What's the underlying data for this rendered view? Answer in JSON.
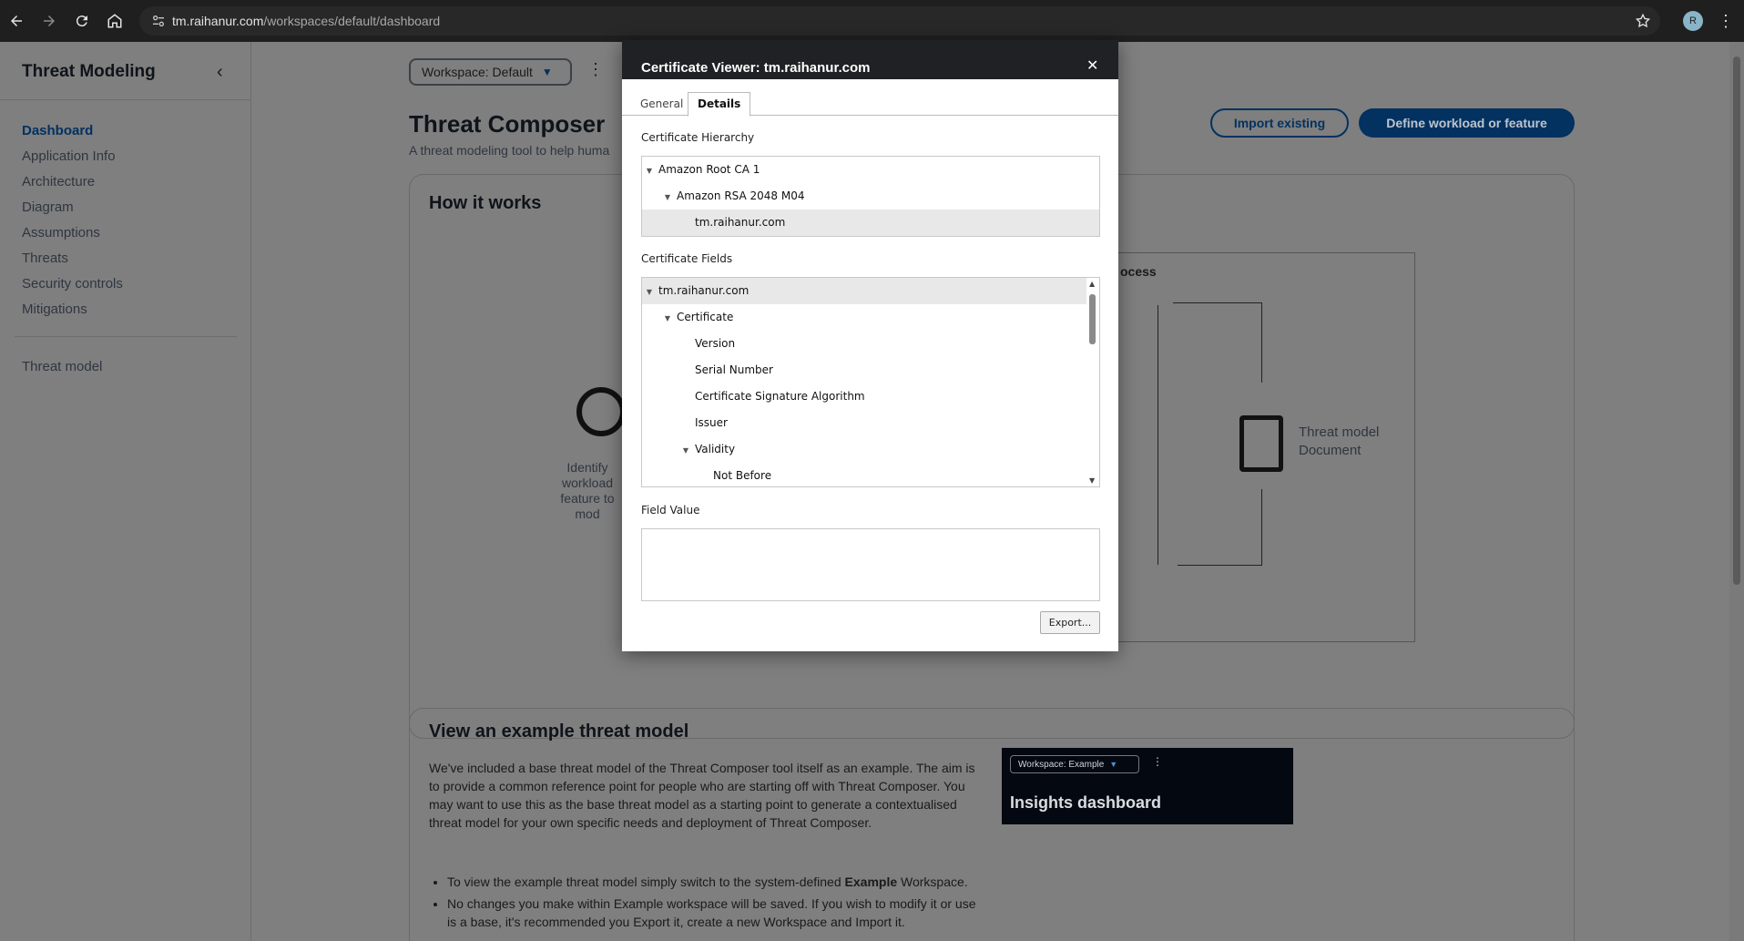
{
  "browser": {
    "url_host": "tm.raihanur.com",
    "url_path": "/workspaces/default/dashboard",
    "profile_initial": "R"
  },
  "sidebar": {
    "title": "Threat Modeling",
    "items": [
      {
        "label": "Dashboard",
        "active": true
      },
      {
        "label": "Application Info"
      },
      {
        "label": "Architecture"
      },
      {
        "label": "Diagram"
      },
      {
        "label": "Assumptions"
      },
      {
        "label": "Threats"
      },
      {
        "label": "Security controls"
      },
      {
        "label": "Mitigations"
      }
    ],
    "threat_model_label": "Threat model"
  },
  "main": {
    "workspace_select": "Workspace: Default",
    "title": "Threat Composer",
    "subtitle": "A threat modeling tool to help huma",
    "import_button": "Import existing",
    "define_button": "Define workload or feature",
    "how_it_works": {
      "title": "How it works",
      "identify_text": "Identify workload feature to mod",
      "process_label": "ocess",
      "doc_label_1": "Threat model",
      "doc_label_2": "Document"
    },
    "example": {
      "title": "View an example threat model",
      "body": "We've included a base threat model of the Threat Composer tool itself as an example. The aim is to provide a common reference point for people who are starting off with Threat Composer. You may want to use this as the base threat model as a starting point to generate a contextualised threat model for your own specific needs and deployment of Threat Composer.",
      "bullet1_prefix": "To view the example threat model simply switch to the system-defined ",
      "bullet1_bold": "Example",
      "bullet1_suffix": " Workspace.",
      "bullet2": "No changes you make within Example workspace will be saved. If you wish to modify it or use is a base, it's recommended you Export it, create a new Workspace and Import it.",
      "preview_workspace": "Workspace: Example",
      "preview_title": "Insights dashboard"
    }
  },
  "dialog": {
    "title": "Certificate Viewer: tm.raihanur.com",
    "tabs": {
      "general": "General",
      "details": "Details"
    },
    "hierarchy_label": "Certificate Hierarchy",
    "hierarchy": [
      "Amazon Root CA 1",
      "Amazon RSA 2048 M04",
      "tm.raihanur.com"
    ],
    "fields_label": "Certificate Fields",
    "fields": [
      "tm.raihanur.com",
      "Certificate",
      "Version",
      "Serial Number",
      "Certificate Signature Algorithm",
      "Issuer",
      "Validity",
      "Not Before"
    ],
    "field_value_label": "Field Value",
    "export_button": "Export..."
  }
}
